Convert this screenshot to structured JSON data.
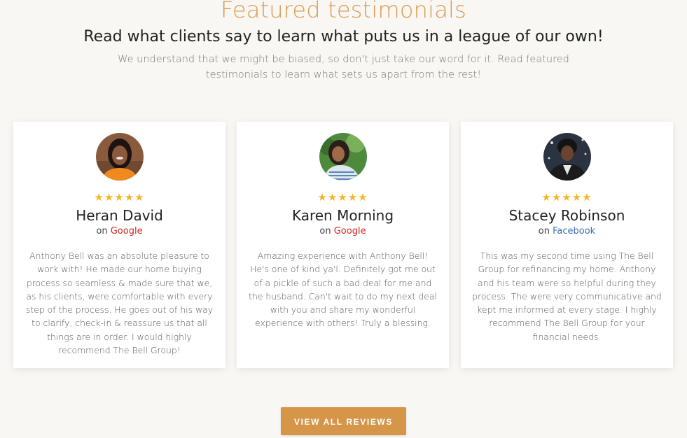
{
  "header": {
    "title": "Featured testimonials",
    "subtitle": "Read what clients say to learn what puts us in a league of our own!",
    "intro": "We understand that we might be biased, so don't just take our word for it. Read featured testimonials to learn what sets us apart from the rest!"
  },
  "testimonials": [
    {
      "avatar": "avatar-photo-woman-orange-top",
      "stars": "★★★★★",
      "rating": 5,
      "name": "Heran David",
      "source_prefix": "on ",
      "source": "Google",
      "source_color": "#d9261c",
      "text": "Anthony Bell was an absolute pleasure to work with! He made our home buying process so seamless & made sure that we, as his clients, were comfortable with every step of the process. He goes out of his way to clarify, check-in & reassure us that all things are in order. I would highly recommend The Bell Group!"
    },
    {
      "avatar": "avatar-photo-woman-outdoors",
      "stars": "★★★★★",
      "rating": 5,
      "name": "Karen Morning",
      "source_prefix": "on ",
      "source": "Google",
      "source_color": "#d9261c",
      "text": "Amazing experience with Anthony Bell! He's one of kind ya'l. Definitely got me out of a pickle of such a bad deal for me and the husband. Can't wait to do my next deal with you and share my wonderful experience with others! Truly a blessing."
    },
    {
      "avatar": "avatar-photo-woman-dark-blazer",
      "stars": "★★★★★",
      "rating": 5,
      "name": "Stacey Robinson",
      "source_prefix": "on ",
      "source": "Facebook",
      "source_color": "#3b6db5",
      "text": "This was my second time using The Bell Group for refinancing my home. Anthony and his team were so helpful during they process. The were very communicative and kept me informed at every stage. I highly recommend The Bell Group for your financial needs."
    }
  ],
  "cta": {
    "label": "VIEW ALL REVIEWS"
  },
  "colors": {
    "accent": "#dc9a4e",
    "button": "#d5964a",
    "star": "#f3b52b",
    "background": "#f8f7f4"
  }
}
